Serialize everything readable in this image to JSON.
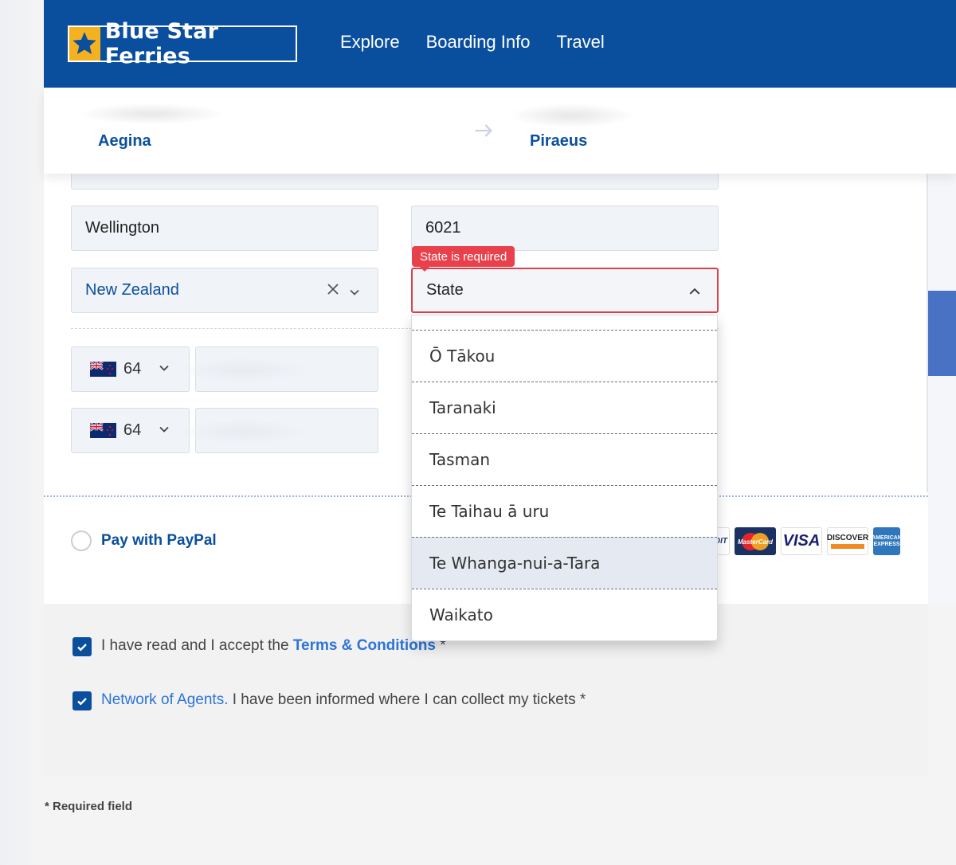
{
  "header": {
    "logo_text": "Blue Star Ferries",
    "nav": [
      "Explore",
      "Boarding Info",
      "Travel"
    ]
  },
  "route": {
    "from": "Aegina",
    "to": "Piraeus"
  },
  "form": {
    "city": "Wellington",
    "postcode": "6021",
    "country": "New Zealand",
    "state_placeholder": "State",
    "state_error": "State is required",
    "phone_code_1": "64",
    "phone_code_2": "64"
  },
  "state_options": [
    "Ō Tākou",
    "Taranaki",
    "Tasman",
    "Te Taihau ā uru",
    "Te Whanga-nui-a-Tara",
    "Waikato"
  ],
  "state_highlighted": "Te Whanga-nui-a-Tara",
  "payment": {
    "paypal_label": "Pay with PayPal",
    "card_brands": [
      "MasterCard",
      "VISA",
      "DISCOVER",
      "AMERICAN EXPRESS"
    ]
  },
  "consent": {
    "terms_prefix": "I have read and I accept the ",
    "terms_link": "Terms & Conditions",
    "terms_suffix": " *",
    "agents_link": "Network of Agents.",
    "agents_text": " I have been informed where I can collect my tickets *"
  },
  "required_note": "* Required field",
  "colors": {
    "brand_blue": "#0a4f9e",
    "logo_yellow": "#f4b120",
    "error_red": "#e9414c",
    "link_blue": "#2c74d8"
  }
}
